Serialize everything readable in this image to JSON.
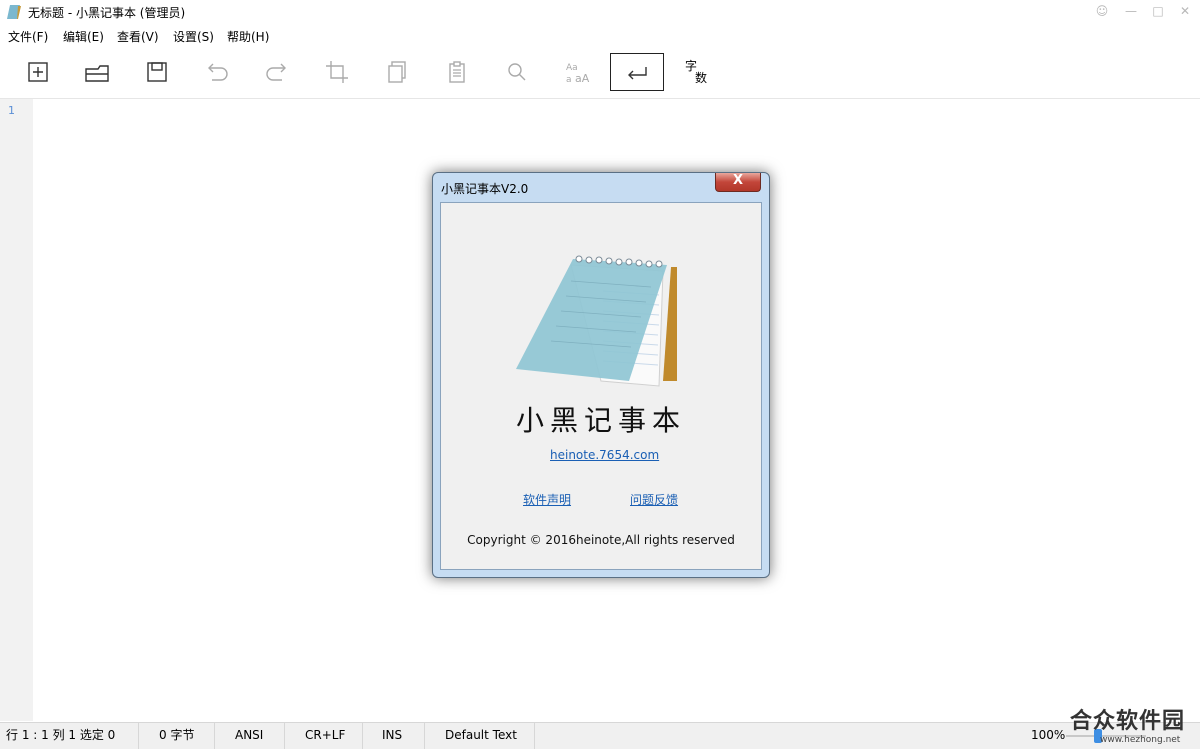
{
  "window": {
    "title": "无标题 - 小黑记事本 (管理员)",
    "controls": [
      "minimize-icon",
      "maximize-icon",
      "close-icon"
    ]
  },
  "menu": [
    {
      "label": "文件(F)"
    },
    {
      "label": "编辑(E)"
    },
    {
      "label": "查看(V)"
    },
    {
      "label": "设置(S)"
    },
    {
      "label": "帮助(H)"
    }
  ],
  "toolbar": {
    "buttons": [
      "new-file-icon",
      "open-file-icon",
      "save-icon",
      "undo-icon",
      "redo-icon",
      "crop-icon",
      "copy-icon",
      "paste-icon",
      "search-icon",
      "font-size-icon",
      "word-wrap-icon",
      "word-count-icon"
    ],
    "wordcount_top": "字",
    "wordcount_bottom": "数",
    "active_button": "word-wrap-icon"
  },
  "editor": {
    "line_numbers": [
      "1"
    ]
  },
  "dialog": {
    "title": "小黑记事本V2.0",
    "close_label": "X",
    "app_name": "小黑记事本",
    "website": "heinote.7654.com",
    "link_statement": "软件声明",
    "link_feedback": "问题反馈",
    "copyright": "Copyright © 2016heinote,All rights reserved"
  },
  "statusbar": {
    "position": "行 1 : 1   列 1   选定 0",
    "bytes": "0 字节",
    "encoding": "ANSI",
    "line_ending": "CR+LF",
    "mode": "INS",
    "syntax": "Default Text",
    "zoom": "100%",
    "zoom_level_fraction": 0.35
  },
  "watermark": {
    "brand": "合众软件园",
    "url": "www.hezhong.net"
  },
  "colors": {
    "accent": "#3d8ee3",
    "link": "#1a5fb4",
    "dialog_frame": "#c6dcf2",
    "close_button": "#c3463a"
  }
}
